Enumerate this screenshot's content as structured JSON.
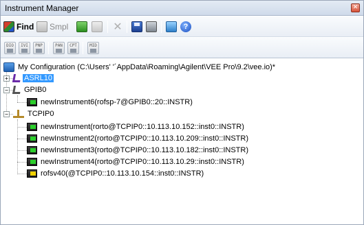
{
  "window": {
    "title": "Instrument Manager"
  },
  "toolbar": {
    "find_label": "Find",
    "smpl_label": "Smpl"
  },
  "toolbar2": {
    "buttons": [
      "DIO",
      "IVI",
      "PNP",
      "PAN",
      "CPT",
      "MID"
    ]
  },
  "tree": {
    "root_label": "My Configuration (C:\\Users'                    '´AppData\\Roaming\\Agilent\\VEE Pro\\9.2\\vee.io)*",
    "asrl_label": "ASRL10",
    "gpib_label": "GPIB0",
    "gpib_instruments": [
      "newInstrument6(rofsp-7@GPIB0::20::INSTR)"
    ],
    "tcpip_label": "TCPIP0",
    "tcpip_instruments": [
      "newInstrument(rorto@TCPIP0::10.113.10.152::inst0::INSTR)",
      "newInstrument2(rorto@TCPIP0::10.113.10.209::inst0::INSTR)",
      "newInstrument3(rorto@TCPIP0::10.113.10.182::inst0::INSTR)",
      "newInstrument4(rorto@TCPIP0::10.113.10.29::inst0::INSTR)",
      "rofsv40(@TCPIP0::10.113.10.154::inst0::INSTR)"
    ]
  },
  "colors": {
    "selection": "#3399ff",
    "title_bar": "#d8e2ee"
  }
}
